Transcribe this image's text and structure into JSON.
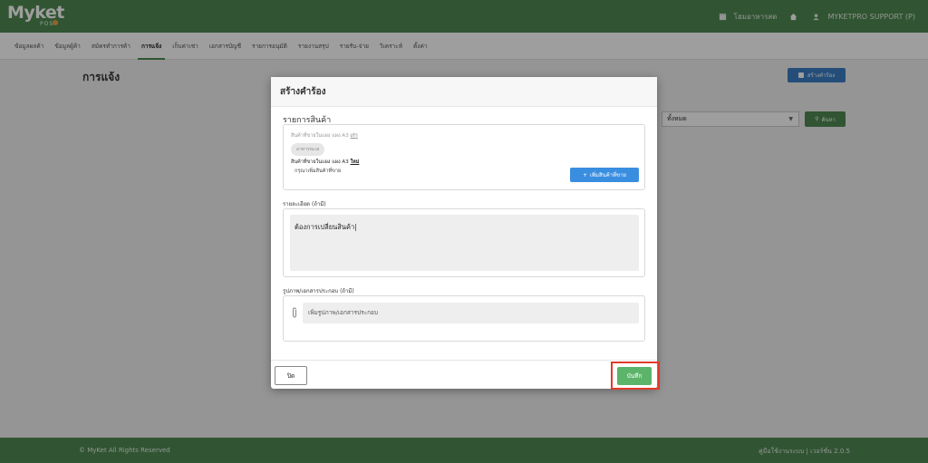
{
  "app": {
    "logo": "Myket",
    "logo_sub": "POS"
  },
  "topbar": {
    "shop_label": "โฮมอาหารสด",
    "user_label": "MYKETPRO SUPPORT (P)"
  },
  "menu": [
    {
      "label": "ข้อมูลผลค้า"
    },
    {
      "label": "ข้อมูลผู้ค้า"
    },
    {
      "label": "สมัครทำการค้า"
    },
    {
      "label": "การแจ้ง",
      "active": true
    },
    {
      "label": "เก็บค่าเช่า"
    },
    {
      "label": "เอกสารบัญชี"
    },
    {
      "label": "รายการอนุมัติ"
    },
    {
      "label": "รายงานสรุป"
    },
    {
      "label": "รายรับ-จ่าย"
    },
    {
      "label": "วิเคราะห์"
    },
    {
      "label": "ตั้งค่า"
    }
  ],
  "page": {
    "title": "การแจ้ง",
    "create_button": "สร้างคำร้อง",
    "filter_value": "ทั้งหมด",
    "search_button": "ค้นหา"
  },
  "modal": {
    "title": "สร้างคำร้อง",
    "section_title": "รายการสินค้า",
    "old_product": "สินค้าที่ขายในแผง แผง A3",
    "old_tag_label": "เก่า",
    "old_chip": "อาหารทะเล",
    "new_product": "สินค้าที่ขายในแผง แผง A3",
    "new_tag_label": "ใหม่",
    "new_hint": "กรุณาเพิ่มสินค้าที่ขาย",
    "add_product_button": "เพิ่มสินค้าที่ขาย",
    "detail_label": "รายละเอียด (ถ้ามี)",
    "detail_value": "ต้องการเปลี่ยนสินค้า|",
    "attach_label": "รูปภาพ/เอกสารประกอบ (ถ้ามี)",
    "attach_placeholder": "เพิ่มรูปภาพ/เอกสารประกอบ",
    "close_button": "ปิด",
    "save_button": "บันทึก"
  },
  "footer": {
    "copyright": "© MyKet All Rights Reserved",
    "version": "คู่มือใช้งานระบบ | เวอร์ชั่น 2.0.5"
  },
  "colors": {
    "brand_green": "#4f8a52",
    "primary_blue": "#3a8ee0",
    "save_green": "#5cb46a",
    "highlight_red": "#e23a2a"
  }
}
